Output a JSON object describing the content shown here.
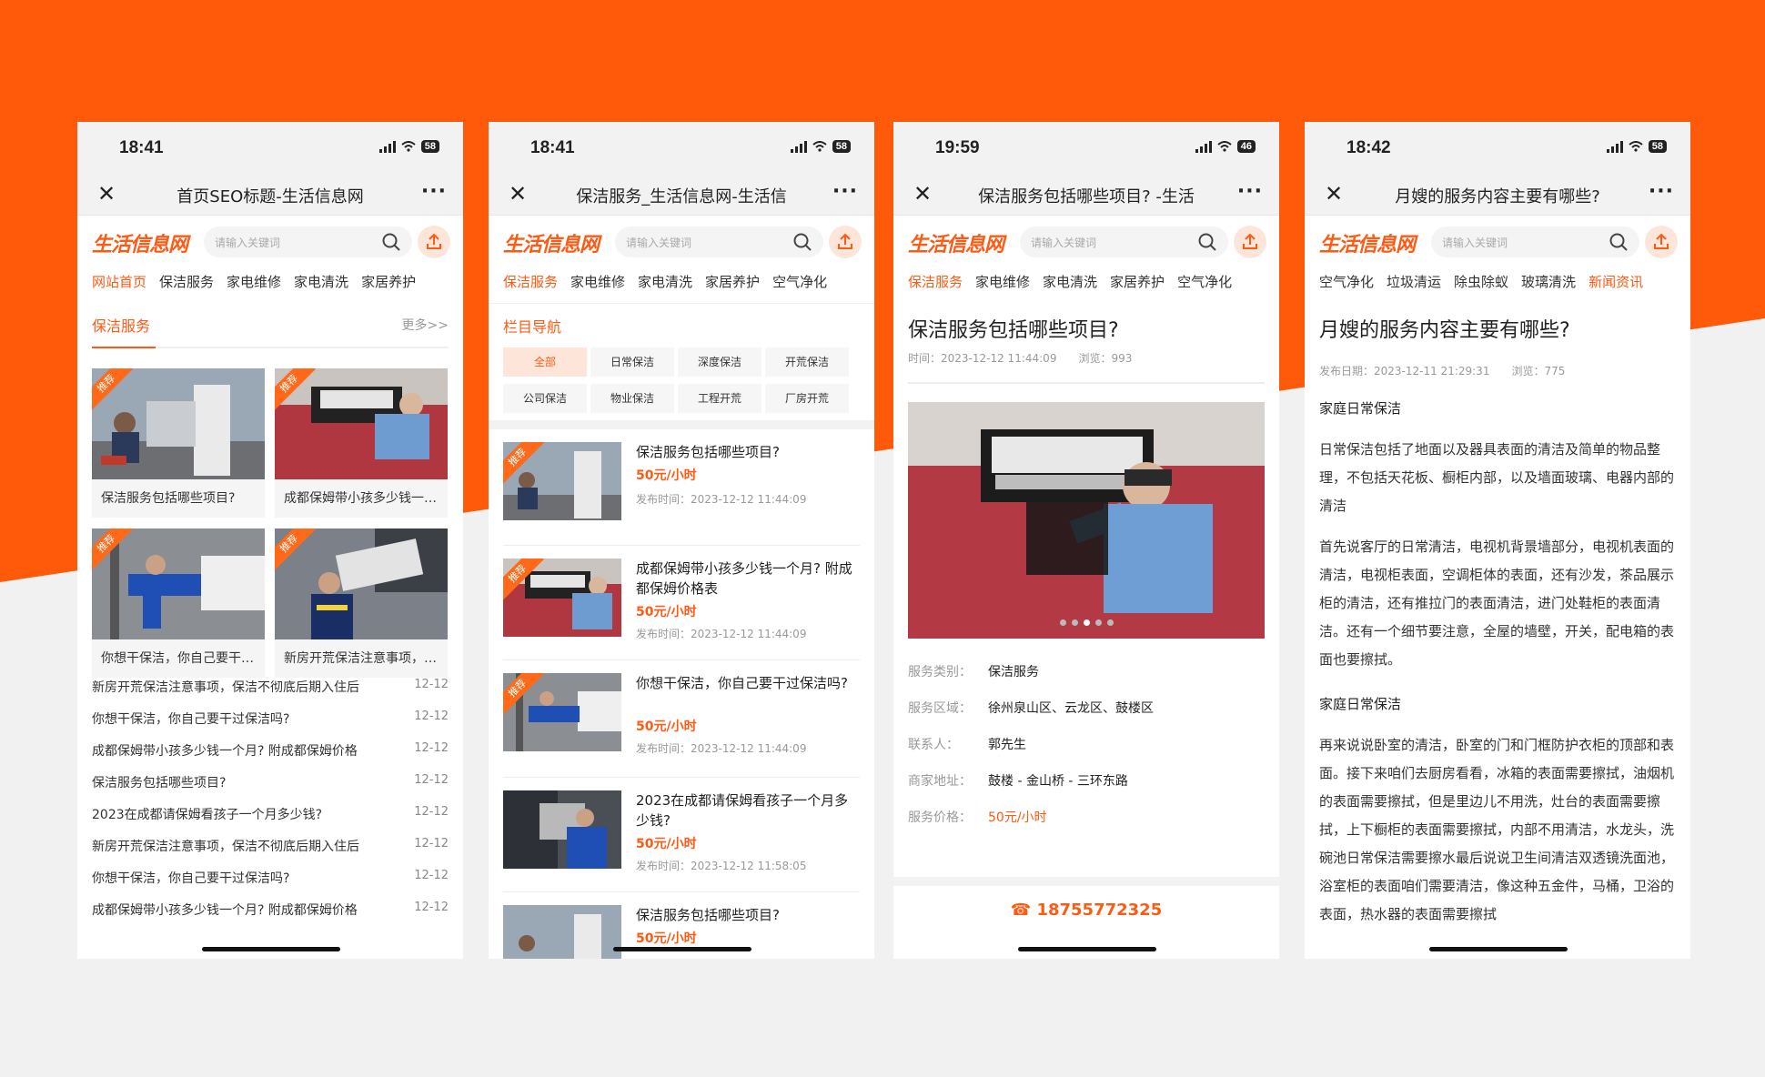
{
  "common": {
    "logo": "生活信息网",
    "search_placeholder": "请输入关键词"
  },
  "colors": {
    "accent": "#ff5a14",
    "accent_light": "#fde6d9",
    "background": "#f1f1f1"
  },
  "phone1": {
    "time": "18:41",
    "battery": "58",
    "title": "首页SEO标题-生活信息网",
    "cats": [
      "网站首页",
      "保洁服务",
      "家电维修",
      "家电清洗",
      "家居养护"
    ],
    "section_title": "保洁服务",
    "section_more": "更多>>",
    "badge": "推荐",
    "cards": [
      "保洁服务包括哪些项目?",
      "成都保姆带小孩多少钱一个月?",
      "你想干保洁，你自己要干过保洁吗?",
      "新房开荒保洁注意事项，保洁不彻底后期入住后"
    ],
    "news": [
      {
        "t": "新房开荒保洁注意事项，保洁不彻底后期入住后",
        "d": "12-12"
      },
      {
        "t": "你想干保洁，你自己要干过保洁吗?",
        "d": "12-12"
      },
      {
        "t": "成都保姆带小孩多少钱一个月? 附成都保姆价格",
        "d": "12-12"
      },
      {
        "t": "保洁服务包括哪些项目?",
        "d": "12-12"
      },
      {
        "t": "2023在成都请保姆看孩子一个月多少钱?",
        "d": "12-12"
      },
      {
        "t": "新房开荒保洁注意事项，保洁不彻底后期入住后",
        "d": "12-12"
      },
      {
        "t": "你想干保洁，你自己要干过保洁吗?",
        "d": "12-12"
      },
      {
        "t": "成都保姆带小孩多少钱一个月? 附成都保姆价格",
        "d": "12-12"
      }
    ]
  },
  "phone2": {
    "time": "18:41",
    "battery": "58",
    "title": "保洁服务_生活信息网-生活信",
    "cats": [
      "保洁服务",
      "家电维修",
      "家电清洗",
      "家居养护",
      "空气净化"
    ],
    "filter_title": "栏目导航",
    "filters": [
      "全部",
      "日常保洁",
      "深度保洁",
      "开荒保洁",
      "公司保洁",
      "物业保洁",
      "工程开荒",
      "厂房开荒"
    ],
    "badge": "推荐",
    "items": [
      {
        "title": "保洁服务包括哪些项目?",
        "price": "50元/小时",
        "date": "发布时间：2023-12-12 11:44:09"
      },
      {
        "title": "成都保姆带小孩多少钱一个月? 附成都保姆价格表",
        "price": "50元/小时",
        "date": "发布时间：2023-12-12 11:44:09"
      },
      {
        "title": "你想干保洁，你自己要干过保洁吗?",
        "price": "50元/小时",
        "date": "发布时间：2023-12-12 11:44:09"
      },
      {
        "title": "2023在成都请保姆看孩子一个月多少钱?",
        "price": "50元/小时",
        "date": "发布时间：2023-12-12 11:58:05"
      },
      {
        "title": "保洁服务包括哪些项目?",
        "price": "50元/小时",
        "date": ""
      }
    ]
  },
  "phone3": {
    "time": "19:59",
    "battery": "46",
    "title": "保洁服务包括哪些项目? -生活",
    "cats": [
      "保洁服务",
      "家电维修",
      "家电清洗",
      "家居养护",
      "空气净化"
    ],
    "article_title": "保洁服务包括哪些项目?",
    "meta": "时间：2023-12-12 11:44:09　　浏览：993",
    "info": [
      {
        "k": "服务类别：",
        "v": "保洁服务"
      },
      {
        "k": "服务区域：",
        "v": "徐州泉山区、云龙区、鼓楼区"
      },
      {
        "k": "联系人：",
        "v": "郭先生"
      },
      {
        "k": "商家地址：",
        "v": "鼓楼 - 金山桥 - 三环东路"
      },
      {
        "k": "服务价格：",
        "v": "50元/小时"
      }
    ],
    "phone_number": "18755772325"
  },
  "phone4": {
    "time": "18:42",
    "battery": "58",
    "title": "月嫂的服务内容主要有哪些?",
    "cats": [
      "空气净化",
      "垃圾清运",
      "除虫除蚁",
      "玻璃清洗",
      "新闻资讯"
    ],
    "article_title": "月嫂的服务内容主要有哪些?",
    "meta": "发布日期：2023-12-11 21:29:31　　浏览：775",
    "h1": "家庭日常保洁",
    "p1": "日常保洁包括了地面以及器具表面的清洁及简单的物品整理，不包括天花板、橱柜内部，以及墙面玻璃、电器内部的清洁",
    "p2": "首先说客厅的日常清洁，电视机背景墙部分，电视机表面的清洁，电视柜表面，空调柜体的表面，还有沙发，茶品展示柜的清洁，还有推拉门的表面清洁，进门处鞋柜的表面清洁。还有一个细节要注意，全屋的墙壁，开关，配电箱的表面也要擦拭。",
    "h2": "家庭日常保洁",
    "p3": "再来说说卧室的清洁，卧室的门和门框防护衣柜的顶部和表面。接下来咱们去厨房看看，冰箱的表面需要擦拭，油烟机的表面需要擦拭，但是里边儿不用洗，灶台的表面需要擦拭，上下橱柜的表面需要擦拭，内部不用清洁，水龙头，洗碗池日常保洁需要擦水最后说说卫生间清洁双透镜洗面池，浴室柜的表面咱们需要清洁，像这种五金件，马桶，卫浴的表面，热水器的表面需要擦拭"
  }
}
